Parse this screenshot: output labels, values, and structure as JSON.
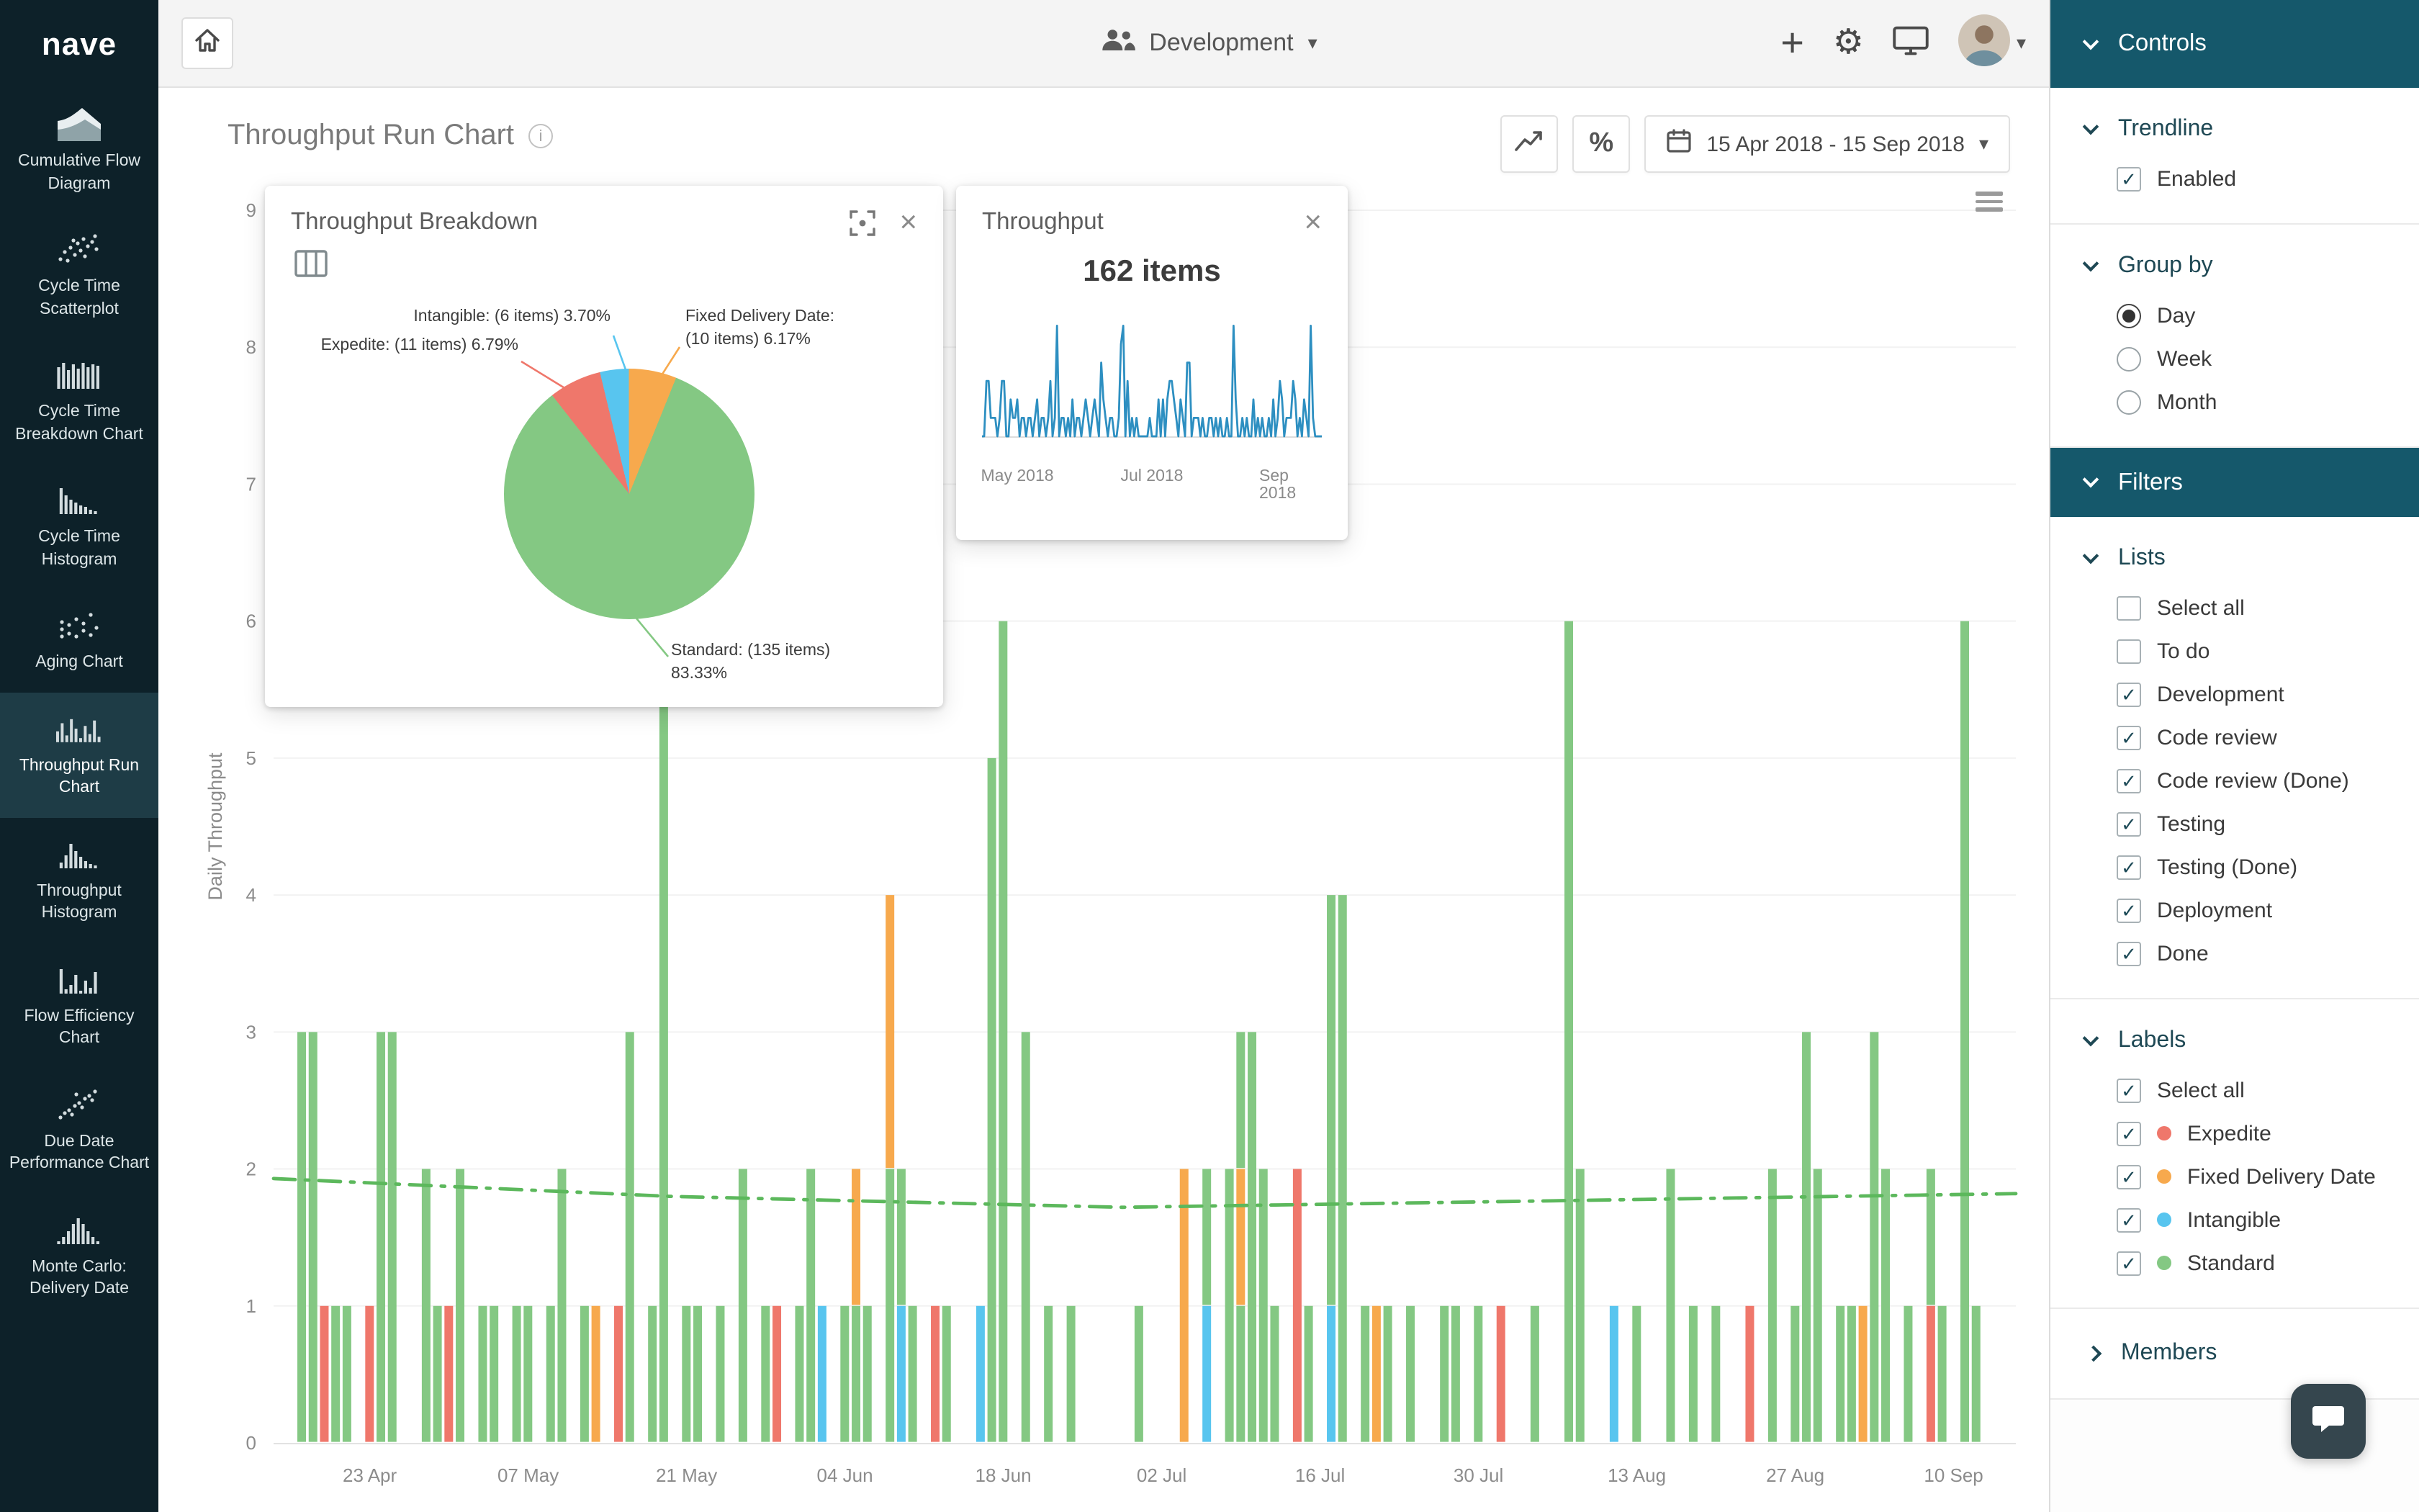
{
  "app": {
    "logo": "nave"
  },
  "topbar": {
    "board": "Development"
  },
  "sidebar": {
    "items": [
      {
        "label": "Cumulative Flow Diagram",
        "icon": "cfd-icon",
        "active": false
      },
      {
        "label": "Cycle Time Scatterplot",
        "icon": "scatterplot-icon",
        "active": false
      },
      {
        "label": "Cycle Time Breakdown Chart",
        "icon": "cycle-breakdown-icon",
        "active": false
      },
      {
        "label": "Cycle Time Histogram",
        "icon": "cycle-histogram-icon",
        "active": false
      },
      {
        "label": "Aging Chart",
        "icon": "aging-icon",
        "active": false
      },
      {
        "label": "Throughput Run Chart",
        "icon": "run-chart-icon",
        "active": true
      },
      {
        "label": "Throughput Histogram",
        "icon": "throughput-histogram-icon",
        "active": false
      },
      {
        "label": "Flow Efficiency Chart",
        "icon": "flow-efficiency-icon",
        "active": false
      },
      {
        "label": "Due Date Performance Chart",
        "icon": "due-date-icon",
        "active": false
      },
      {
        "label": "Monte Carlo: Delivery Date",
        "icon": "monte-carlo-icon",
        "active": false
      }
    ]
  },
  "main": {
    "title": "Throughput Run Chart",
    "percent_label": "%",
    "date_range": "15 Apr 2018 - 15 Sep 2018"
  },
  "breakdown_panel": {
    "title": "Throughput Breakdown",
    "slices": [
      {
        "name": "Expedite",
        "items": 11,
        "pct": 6.79,
        "color": "#ef776b",
        "lines": [
          "Expedite: (11 items) 6.79%"
        ]
      },
      {
        "name": "Intangible",
        "items": 6,
        "pct": 3.7,
        "color": "#58c5ef",
        "lines": [
          "Intangible: (6 items) 3.70%"
        ]
      },
      {
        "name": "Fixed Delivery Date",
        "items": 10,
        "pct": 6.17,
        "color": "#f7a94d",
        "lines": [
          "Fixed Delivery Date:",
          "(10 items) 6.17%"
        ]
      },
      {
        "name": "Standard",
        "items": 135,
        "pct": 83.33,
        "color": "#84c883",
        "lines": [
          "Standard: (135 items)",
          "83.33%"
        ]
      }
    ]
  },
  "throughput_panel": {
    "title": "Throughput",
    "total": "162 items",
    "x_labels": [
      {
        "label": "May 2018",
        "day": 16
      },
      {
        "label": "Jul 2018",
        "day": 77
      },
      {
        "label": "Sep 2018",
        "day": 139
      }
    ]
  },
  "controls": {
    "header": "Controls",
    "trendline": {
      "title": "Trendline",
      "option": "Enabled",
      "checked": true
    },
    "group_by": {
      "title": "Group by",
      "options": [
        {
          "label": "Day",
          "selected": true
        },
        {
          "label": "Week",
          "selected": false
        },
        {
          "label": "Month",
          "selected": false
        }
      ]
    },
    "filters_header": "Filters",
    "lists": {
      "title": "Lists",
      "items": [
        {
          "label": "Select all",
          "checked": false
        },
        {
          "label": "To do",
          "checked": false
        },
        {
          "label": "Development",
          "checked": true
        },
        {
          "label": "Code review",
          "checked": true
        },
        {
          "label": "Code review (Done)",
          "checked": true
        },
        {
          "label": "Testing",
          "checked": true
        },
        {
          "label": "Testing (Done)",
          "checked": true
        },
        {
          "label": "Deployment",
          "checked": true
        },
        {
          "label": "Done",
          "checked": true
        }
      ]
    },
    "labels": {
      "title": "Labels",
      "items": [
        {
          "label": "Select all",
          "checked": true
        },
        {
          "label": "Expedite",
          "checked": true,
          "dot": "#ef776b"
        },
        {
          "label": "Fixed Delivery Date",
          "checked": true,
          "dot": "#f7a94d"
        },
        {
          "label": "Intangible",
          "checked": true,
          "dot": "#58c5ef"
        },
        {
          "label": "Standard",
          "checked": true,
          "dot": "#84c883"
        }
      ]
    },
    "members": {
      "title": "Members"
    }
  },
  "chart_data": {
    "type": "bar",
    "stacked": true,
    "title": "Throughput Run Chart",
    "ylabel": "Daily Throughput",
    "ylim": [
      0,
      9
    ],
    "grid": "horizontal",
    "x_start": "15 Apr 2018",
    "x_end": "15 Sep 2018",
    "days": 154,
    "x_ticks": [
      {
        "day": 8,
        "label": "23 Apr"
      },
      {
        "day": 22,
        "label": "07 May"
      },
      {
        "day": 36,
        "label": "21 May"
      },
      {
        "day": 50,
        "label": "04 Jun"
      },
      {
        "day": 64,
        "label": "18 Jun"
      },
      {
        "day": 78,
        "label": "02 Jul"
      },
      {
        "day": 92,
        "label": "16 Jul"
      },
      {
        "day": 106,
        "label": "30 Jul"
      },
      {
        "day": 120,
        "label": "13 Aug"
      },
      {
        "day": 134,
        "label": "27 Aug"
      },
      {
        "day": 148,
        "label": "10 Sep"
      }
    ],
    "series_colors": {
      "standard": "#84c883",
      "expedite": "#ef776b",
      "fixed_delivery_date": "#f7a94d",
      "intangible": "#58c5ef"
    },
    "totals": {
      "standard": 135,
      "expedite": 11,
      "fixed_delivery_date": 10,
      "intangible": 6,
      "total": 162
    },
    "trendline": {
      "enabled": true,
      "color": "#5cb85c",
      "style": "dashdot",
      "points": [
        [
          0,
          1.93
        ],
        [
          35,
          1.8
        ],
        [
          75,
          1.72
        ],
        [
          115,
          1.77
        ],
        [
          154,
          1.82
        ]
      ]
    },
    "bars": [
      {
        "d": 2,
        "seg": [
          [
            "standard",
            3
          ]
        ]
      },
      {
        "d": 3,
        "seg": [
          [
            "standard",
            3
          ]
        ]
      },
      {
        "d": 4,
        "seg": [
          [
            "expedite",
            1
          ]
        ]
      },
      {
        "d": 5,
        "seg": [
          [
            "standard",
            1
          ]
        ]
      },
      {
        "d": 6,
        "seg": [
          [
            "standard",
            1
          ]
        ]
      },
      {
        "d": 8,
        "seg": [
          [
            "expedite",
            1
          ]
        ]
      },
      {
        "d": 9,
        "seg": [
          [
            "standard",
            3
          ]
        ]
      },
      {
        "d": 10,
        "seg": [
          [
            "standard",
            3
          ]
        ]
      },
      {
        "d": 13,
        "seg": [
          [
            "standard",
            2
          ]
        ]
      },
      {
        "d": 14,
        "seg": [
          [
            "standard",
            1
          ]
        ]
      },
      {
        "d": 15,
        "seg": [
          [
            "expedite",
            1
          ]
        ]
      },
      {
        "d": 16,
        "seg": [
          [
            "standard",
            2
          ]
        ]
      },
      {
        "d": 18,
        "seg": [
          [
            "standard",
            1
          ]
        ]
      },
      {
        "d": 19,
        "seg": [
          [
            "standard",
            1
          ]
        ]
      },
      {
        "d": 21,
        "seg": [
          [
            "standard",
            1
          ]
        ]
      },
      {
        "d": 22,
        "seg": [
          [
            "standard",
            1
          ]
        ]
      },
      {
        "d": 24,
        "seg": [
          [
            "standard",
            1
          ]
        ]
      },
      {
        "d": 25,
        "seg": [
          [
            "standard",
            2
          ]
        ]
      },
      {
        "d": 27,
        "seg": [
          [
            "standard",
            1
          ]
        ]
      },
      {
        "d": 28,
        "seg": [
          [
            "fixed_delivery_date",
            1
          ]
        ]
      },
      {
        "d": 30,
        "seg": [
          [
            "expedite",
            1
          ]
        ]
      },
      {
        "d": 31,
        "seg": [
          [
            "standard",
            3
          ]
        ]
      },
      {
        "d": 33,
        "seg": [
          [
            "standard",
            1
          ]
        ]
      },
      {
        "d": 34,
        "seg": [
          [
            "standard",
            6
          ]
        ]
      },
      {
        "d": 36,
        "seg": [
          [
            "standard",
            1
          ]
        ]
      },
      {
        "d": 37,
        "seg": [
          [
            "standard",
            1
          ]
        ]
      },
      {
        "d": 39,
        "seg": [
          [
            "standard",
            1
          ]
        ]
      },
      {
        "d": 41,
        "seg": [
          [
            "standard",
            2
          ]
        ]
      },
      {
        "d": 43,
        "seg": [
          [
            "standard",
            1
          ]
        ]
      },
      {
        "d": 44,
        "seg": [
          [
            "expedite",
            1
          ]
        ]
      },
      {
        "d": 46,
        "seg": [
          [
            "standard",
            1
          ]
        ]
      },
      {
        "d": 47,
        "seg": [
          [
            "standard",
            2
          ]
        ]
      },
      {
        "d": 48,
        "seg": [
          [
            "intangible",
            1
          ]
        ]
      },
      {
        "d": 50,
        "seg": [
          [
            "standard",
            1
          ]
        ]
      },
      {
        "d": 51,
        "seg": [
          [
            "standard",
            1
          ],
          [
            "fixed_delivery_date",
            1
          ]
        ]
      },
      {
        "d": 52,
        "seg": [
          [
            "standard",
            1
          ]
        ]
      },
      {
        "d": 54,
        "seg": [
          [
            "standard",
            2
          ],
          [
            "fixed_delivery_date",
            2
          ]
        ]
      },
      {
        "d": 55,
        "seg": [
          [
            "intangible",
            1
          ],
          [
            "standard",
            1
          ]
        ]
      },
      {
        "d": 56,
        "seg": [
          [
            "standard",
            1
          ]
        ]
      },
      {
        "d": 58,
        "seg": [
          [
            "expedite",
            1
          ]
        ]
      },
      {
        "d": 59,
        "seg": [
          [
            "standard",
            1
          ]
        ]
      },
      {
        "d": 62,
        "seg": [
          [
            "intangible",
            1
          ]
        ]
      },
      {
        "d": 63,
        "seg": [
          [
            "standard",
            5
          ]
        ]
      },
      {
        "d": 64,
        "seg": [
          [
            "standard",
            6
          ]
        ]
      },
      {
        "d": 66,
        "seg": [
          [
            "standard",
            3
          ]
        ]
      },
      {
        "d": 68,
        "seg": [
          [
            "standard",
            1
          ]
        ]
      },
      {
        "d": 70,
        "seg": [
          [
            "standard",
            1
          ]
        ]
      },
      {
        "d": 76,
        "seg": [
          [
            "standard",
            1
          ]
        ]
      },
      {
        "d": 80,
        "seg": [
          [
            "fixed_delivery_date",
            2
          ]
        ]
      },
      {
        "d": 82,
        "seg": [
          [
            "intangible",
            1
          ],
          [
            "standard",
            1
          ]
        ]
      },
      {
        "d": 84,
        "seg": [
          [
            "standard",
            2
          ]
        ]
      },
      {
        "d": 85,
        "seg": [
          [
            "standard",
            1
          ],
          [
            "fixed_delivery_date",
            1
          ],
          [
            "standard",
            1
          ]
        ]
      },
      {
        "d": 86,
        "seg": [
          [
            "standard",
            3
          ]
        ]
      },
      {
        "d": 87,
        "seg": [
          [
            "standard",
            2
          ]
        ]
      },
      {
        "d": 88,
        "seg": [
          [
            "standard",
            1
          ]
        ]
      },
      {
        "d": 90,
        "seg": [
          [
            "expedite",
            2
          ]
        ]
      },
      {
        "d": 91,
        "seg": [
          [
            "standard",
            1
          ]
        ]
      },
      {
        "d": 93,
        "seg": [
          [
            "intangible",
            1
          ],
          [
            "standard",
            3
          ]
        ]
      },
      {
        "d": 94,
        "seg": [
          [
            "standard",
            4
          ]
        ]
      },
      {
        "d": 96,
        "seg": [
          [
            "standard",
            1
          ]
        ]
      },
      {
        "d": 97,
        "seg": [
          [
            "fixed_delivery_date",
            1
          ]
        ]
      },
      {
        "d": 98,
        "seg": [
          [
            "standard",
            1
          ]
        ]
      },
      {
        "d": 100,
        "seg": [
          [
            "standard",
            1
          ]
        ]
      },
      {
        "d": 103,
        "seg": [
          [
            "standard",
            1
          ]
        ]
      },
      {
        "d": 104,
        "seg": [
          [
            "standard",
            1
          ]
        ]
      },
      {
        "d": 106,
        "seg": [
          [
            "standard",
            1
          ]
        ]
      },
      {
        "d": 108,
        "seg": [
          [
            "expedite",
            1
          ]
        ]
      },
      {
        "d": 111,
        "seg": [
          [
            "standard",
            1
          ]
        ]
      },
      {
        "d": 114,
        "seg": [
          [
            "standard",
            6
          ]
        ]
      },
      {
        "d": 115,
        "seg": [
          [
            "standard",
            2
          ]
        ]
      },
      {
        "d": 118,
        "seg": [
          [
            "intangible",
            1
          ]
        ]
      },
      {
        "d": 120,
        "seg": [
          [
            "standard",
            1
          ]
        ]
      },
      {
        "d": 123,
        "seg": [
          [
            "standard",
            2
          ]
        ]
      },
      {
        "d": 125,
        "seg": [
          [
            "standard",
            1
          ]
        ]
      },
      {
        "d": 127,
        "seg": [
          [
            "standard",
            1
          ]
        ]
      },
      {
        "d": 130,
        "seg": [
          [
            "expedite",
            1
          ]
        ]
      },
      {
        "d": 132,
        "seg": [
          [
            "standard",
            2
          ]
        ]
      },
      {
        "d": 134,
        "seg": [
          [
            "standard",
            1
          ]
        ]
      },
      {
        "d": 135,
        "seg": [
          [
            "standard",
            3
          ]
        ]
      },
      {
        "d": 136,
        "seg": [
          [
            "standard",
            2
          ]
        ]
      },
      {
        "d": 138,
        "seg": [
          [
            "standard",
            1
          ]
        ]
      },
      {
        "d": 139,
        "seg": [
          [
            "standard",
            1
          ]
        ]
      },
      {
        "d": 140,
        "seg": [
          [
            "fixed_delivery_date",
            1
          ]
        ]
      },
      {
        "d": 141,
        "seg": [
          [
            "standard",
            3
          ]
        ]
      },
      {
        "d": 142,
        "seg": [
          [
            "standard",
            2
          ]
        ]
      },
      {
        "d": 144,
        "seg": [
          [
            "standard",
            1
          ]
        ]
      },
      {
        "d": 146,
        "seg": [
          [
            "expedite",
            1
          ],
          [
            "standard",
            1
          ]
        ]
      },
      {
        "d": 147,
        "seg": [
          [
            "standard",
            1
          ]
        ]
      },
      {
        "d": 149,
        "seg": [
          [
            "standard",
            6
          ]
        ]
      },
      {
        "d": 150,
        "seg": [
          [
            "standard",
            1
          ]
        ]
      }
    ]
  }
}
